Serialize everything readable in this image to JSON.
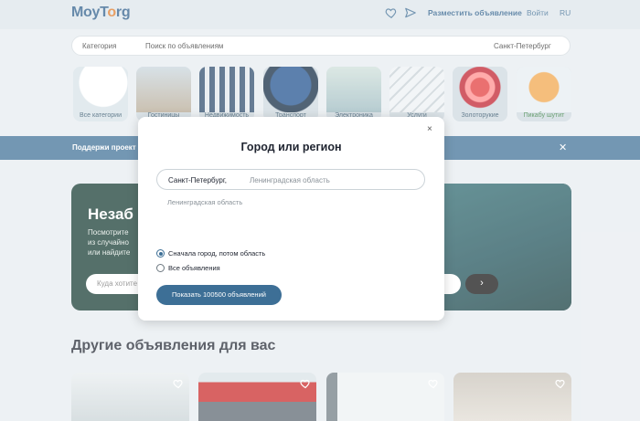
{
  "header": {
    "logo_part1": "Moy",
    "logo_part2": "T",
    "logo_o": "o",
    "logo_part3": "rg",
    "post_ad": "Разместить объявление",
    "login": "Войти",
    "lang": "RU",
    "icons": [
      "heart-icon",
      "send-icon"
    ]
  },
  "search": {
    "category": "Категория",
    "placeholder": "Поиск по объявлениям",
    "city": "Санкт-Петербург"
  },
  "categories": [
    {
      "label": "Все категории"
    },
    {
      "label": "Гостиницы"
    },
    {
      "label": "Недвижимость"
    },
    {
      "label": "Транспорт"
    },
    {
      "label": "Электроника"
    },
    {
      "label": "Услуги"
    },
    {
      "label": "Золоторукие"
    },
    {
      "label": "Пикабу шутит"
    }
  ],
  "banner": {
    "text": "Поддержи проект"
  },
  "hero": {
    "title": "Незаб",
    "subtitle_1": "Посмотрите",
    "subtitle_2": "из случайно",
    "subtitle_3": "или найдите",
    "input_placeholder": "Куда хотите",
    "go_arrow": "›"
  },
  "section_title": "Другие объявления для вас",
  "modal": {
    "title": "Город или регион",
    "close": "×",
    "field_value": "Санкт-Петербург,",
    "field_hint": "Ленинградская область",
    "suggestion": "Ленинградская область",
    "options": [
      {
        "label": "Сначала город, потом область",
        "selected": true
      },
      {
        "label": "Все объявления",
        "selected": false
      }
    ],
    "button": "Показать 100500 объявлений"
  },
  "colors": {
    "accent": "#3d6f96",
    "logo_blue": "#2b5c8a",
    "logo_orange": "#e07b2a"
  }
}
